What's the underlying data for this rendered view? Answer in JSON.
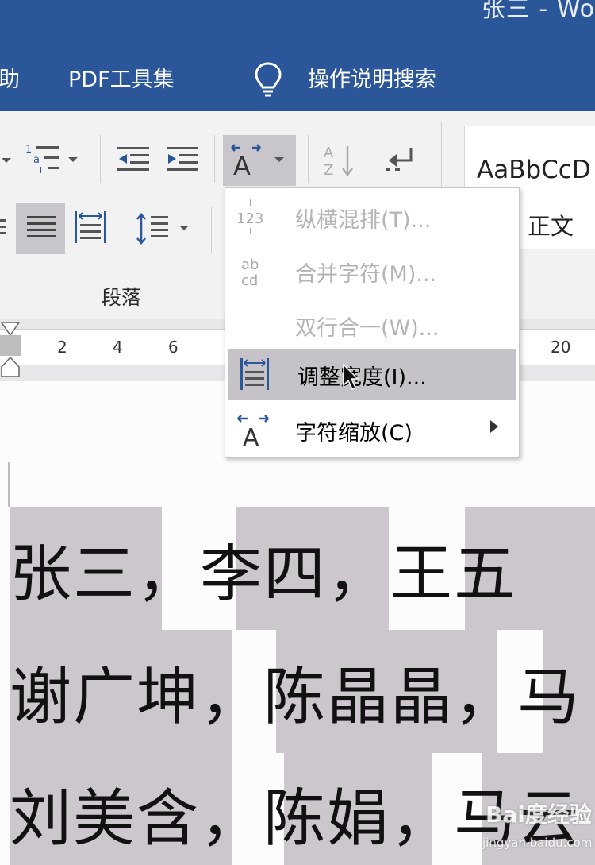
{
  "window": {
    "title": "张三 - Wo"
  },
  "ribbon_tabs": {
    "help": "助",
    "pdf": "PDF工具集",
    "search": "操作说明搜索",
    "search_icon": "lightbulb-icon"
  },
  "paragraph_group": {
    "label": "段落"
  },
  "styles": {
    "sample": "AaBbCcD",
    "name": "正文"
  },
  "ruler": {
    "ticks": [
      "2",
      "4",
      "6",
      "20"
    ]
  },
  "menu": {
    "items": [
      {
        "label": "纵横混排(T)...",
        "icon": "vertical-horizontal-text-icon",
        "enabled": false
      },
      {
        "label": "合并字符(M)...",
        "icon": "combine-characters-icon",
        "enabled": false
      },
      {
        "label": "双行合一(W)...",
        "icon": "",
        "enabled": false
      },
      {
        "label": "调整宽度(I)...",
        "icon": "fit-text-width-icon",
        "enabled": true,
        "hovered": true
      },
      {
        "label": "字符缩放(C)",
        "icon": "character-scale-icon",
        "enabled": true,
        "submenu": true
      }
    ]
  },
  "document": {
    "lines": [
      "张三，李四，王五",
      "谢广坤，陈晶晶，马",
      "刘美含，陈娟，马云"
    ]
  },
  "watermark": {
    "text": "Bai度经验",
    "url": "jingyan.baidu.com"
  },
  "colors": {
    "title_bar": "#2b579a",
    "selection": "#cbc7cd",
    "menu_hover": "#c5c3c7"
  }
}
